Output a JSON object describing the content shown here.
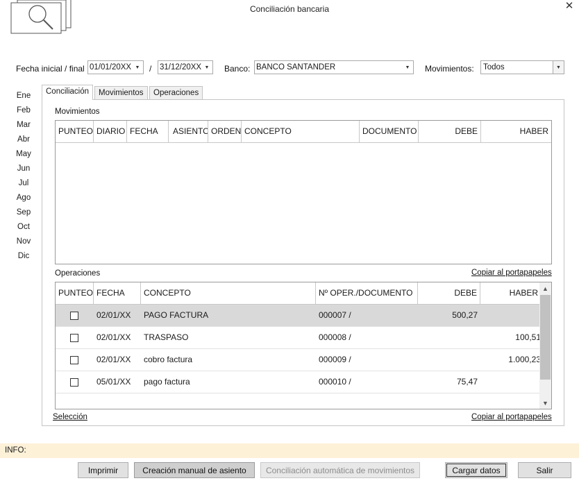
{
  "window": {
    "title": "Conciliación bancaria",
    "close_glyph": "✕"
  },
  "filters": {
    "date_label": "Fecha inicial / final",
    "date_start": "01/01/20XX",
    "date_separator": "/",
    "date_end": "31/12/20XX",
    "bank_label": "Banco:",
    "bank_value": "BANCO SANTANDER",
    "movements_label": "Movimientos:",
    "movements_value": "Todos"
  },
  "months": [
    "Ene",
    "Feb",
    "Mar",
    "Abr",
    "May",
    "Jun",
    "Jul",
    "Ago",
    "Sep",
    "Oct",
    "Nov",
    "Dic"
  ],
  "tabs": [
    {
      "label": "Conciliación",
      "active": true
    },
    {
      "label": "Movimientos",
      "active": false
    },
    {
      "label": "Operaciones",
      "active": false
    }
  ],
  "movimientos": {
    "title": "Movimientos",
    "columns": [
      "PUNTEO",
      "DIARIO",
      "FECHA",
      "ASIENTO",
      "ORDEN",
      "CONCEPTO",
      "DOCUMENTO",
      "DEBE",
      "HABER"
    ]
  },
  "operaciones": {
    "title": "Operaciones",
    "copy_link": "Copiar al portapapeles",
    "columns": [
      "PUNTEO",
      "FECHA",
      "CONCEPTO",
      "Nº OPER./DOCUMENTO",
      "DEBE",
      "HABER"
    ],
    "rows": [
      {
        "fecha": "02/01/XX",
        "concepto": "PAGO FACTURA",
        "documento": "000007 /",
        "debe": "500,27",
        "haber": "",
        "selected": true
      },
      {
        "fecha": "02/01/XX",
        "concepto": "TRASPASO",
        "documento": "000008 /",
        "debe": "",
        "haber": "100,51",
        "selected": false
      },
      {
        "fecha": "02/01/XX",
        "concepto": "cobro factura",
        "documento": "000009 /",
        "debe": "",
        "haber": "1.000,23",
        "selected": false
      },
      {
        "fecha": "05/01/XX",
        "concepto": "pago factura",
        "documento": "000010 /",
        "debe": "75,47",
        "haber": "",
        "selected": false
      }
    ]
  },
  "footer_links": {
    "seleccion": "Selección",
    "copy": "Copiar al portapapeles"
  },
  "info": {
    "label": "INFO:"
  },
  "buttons": {
    "imprimir": "Imprimir",
    "creacion": "Creación manual de asiento",
    "conciliacion": "Conciliación automática de movimientos",
    "cargar": "Cargar datos",
    "salir": "Salir"
  }
}
